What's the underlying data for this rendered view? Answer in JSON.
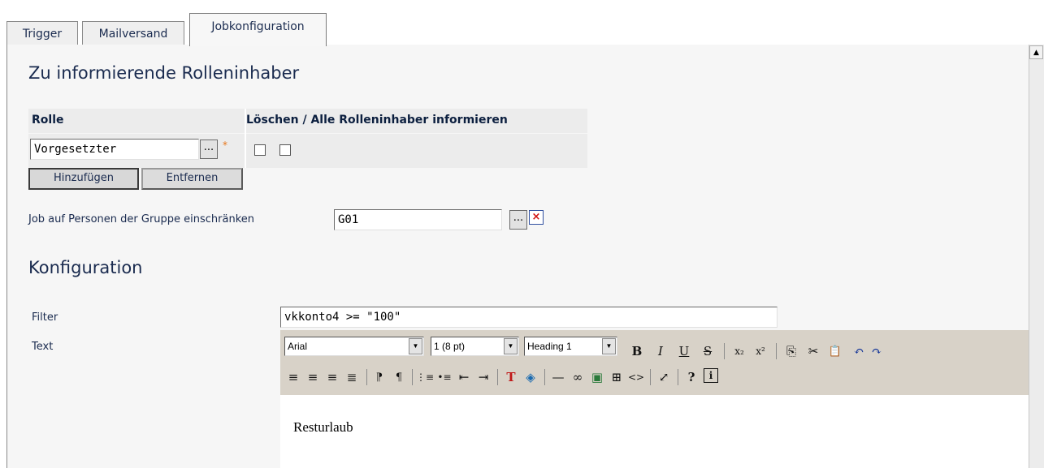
{
  "tabs": [
    {
      "label": "Trigger",
      "active": false
    },
    {
      "label": "Mailversand",
      "active": false
    },
    {
      "label": "Jobkonfiguration",
      "active": true
    }
  ],
  "roles_section": {
    "title": "Zu informierende Rolleninhaber",
    "col_role": "Rolle",
    "col_flags": "Löschen / Alle Rolleninhaber informieren",
    "role_value": "Vorgesetzter",
    "browse_label": "...",
    "required_mark": "*",
    "delete_checked": false,
    "inform_all_checked": false,
    "add_button": "Hinzufügen",
    "remove_button": "Entfernen"
  },
  "group_restriction": {
    "label": "Job auf Personen der Gruppe einschränken",
    "value": "G01",
    "browse_label": "...",
    "clear_label": "×"
  },
  "configuration": {
    "title": "Konfiguration",
    "filter_label": "Filter",
    "filter_value": "vkkonto4 >= \"100\"",
    "text_label": "Text"
  },
  "editor": {
    "font": "Arial",
    "size": "1 (8 pt)",
    "format": "Heading 1",
    "content": "Resturlaub",
    "row1_icons": [
      "bold-icon",
      "italic-icon",
      "underline-icon",
      "strikethrough-icon",
      "subscript-icon",
      "superscript-icon",
      "copy-icon",
      "cut-icon",
      "paste-icon",
      "undo-icon",
      "redo-icon"
    ],
    "row2_icons": [
      "align-left-icon",
      "align-center-icon",
      "align-right-icon",
      "align-justify-icon",
      "ltr-icon",
      "rtl-icon",
      "ordered-list-icon",
      "unordered-list-icon",
      "outdent-icon",
      "indent-icon",
      "text-color-icon",
      "background-color-icon",
      "horizontal-rule-icon",
      "link-icon",
      "image-icon",
      "table-icon",
      "source-icon",
      "fullscreen-icon",
      "help-icon",
      "about-icon"
    ],
    "glyphs": {
      "bold": "B",
      "italic": "I",
      "underline": "U",
      "strike": "S",
      "sub": "x₂",
      "sup": "x²",
      "copy": "⎘",
      "cut": "✂",
      "paste": "📋",
      "undo": "↶",
      "redo": "↷",
      "align_left": "≡",
      "align_center": "≡",
      "align_right": "≡",
      "justify": "≣",
      "ltr": "⁋",
      "rtl": "¶",
      "ol": "⋮≡",
      "ul": "•≡",
      "outdent": "⇤",
      "indent": "⇥",
      "text_color": "T",
      "bg_color": "◈",
      "hr": "—",
      "link": "∞",
      "image": "▣",
      "table": "⊞",
      "source": "<>",
      "fullscreen": "⤢",
      "help": "?",
      "about": "i"
    }
  }
}
